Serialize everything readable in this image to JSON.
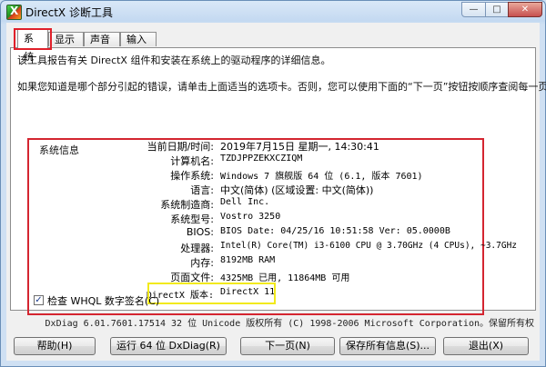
{
  "window": {
    "title": "DirectX 诊断工具",
    "caption": {
      "minimize": "—",
      "maximize": "□",
      "close": "✕"
    }
  },
  "tabs": [
    {
      "label": "系统",
      "active": true
    },
    {
      "label": "显示",
      "active": false
    },
    {
      "label": "声音",
      "active": false
    },
    {
      "label": "输入",
      "active": false
    }
  ],
  "intro": {
    "line1": "该工具报告有关 DirectX 组件和安装在系统上的驱动程序的详细信息。",
    "line2": "如果您知道是哪个部分引起的错误，请单击上面适当的选项卡。否则，您可以使用下面的“下一页”按钮按顺序查阅每一页。"
  },
  "system_info": {
    "legend": "系统信息",
    "rows": [
      {
        "label": "当前日期/时间:",
        "value": "2019年7月15日 星期一, 14:30:41"
      },
      {
        "label": "计算机名:",
        "value": "TZDJPPZEKXCZIQM"
      },
      {
        "label": "操作系统:",
        "value": "Windows 7 旗舰版 64 位 (6.1, 版本 7601)"
      },
      {
        "label": "语言:",
        "value": "中文(简体) (区域设置: 中文(简体))"
      },
      {
        "label": "系统制造商:",
        "value": "Dell Inc."
      },
      {
        "label": "系统型号:",
        "value": "Vostro 3250"
      },
      {
        "label": "BIOS:",
        "value": "BIOS Date: 04/25/16 10:51:58 Ver: 05.0000B"
      },
      {
        "label": "处理器:",
        "value": "Intel(R) Core(TM) i3-6100 CPU @ 3.70GHz (4 CPUs), ~3.7GHz"
      },
      {
        "label": "内存:",
        "value": "8192MB RAM"
      },
      {
        "label": "页面文件:",
        "value": "4325MB 已用, 11864MB 可用"
      },
      {
        "label": "DirectX 版本:",
        "value": "DirectX 11"
      }
    ]
  },
  "whql": {
    "checked": true,
    "label": "检查 WHQL 数字签名(C)",
    "check_glyph": "✓"
  },
  "footer": "DxDiag 6.01.7601.17514 32 位 Unicode 版权所有 (C) 1998-2006 Microsoft Corporation。保留所有权",
  "buttons": {
    "help": "帮助(H)",
    "run64": "运行 64 位 DxDiag(R)",
    "next": "下一页(N)",
    "save": "保存所有信息(S)...",
    "exit": "退出(X)"
  },
  "colors": {
    "highlight_red": "#d42530",
    "highlight_yellow": "#f2ea1b",
    "title_bg": "#cfe0f3"
  }
}
